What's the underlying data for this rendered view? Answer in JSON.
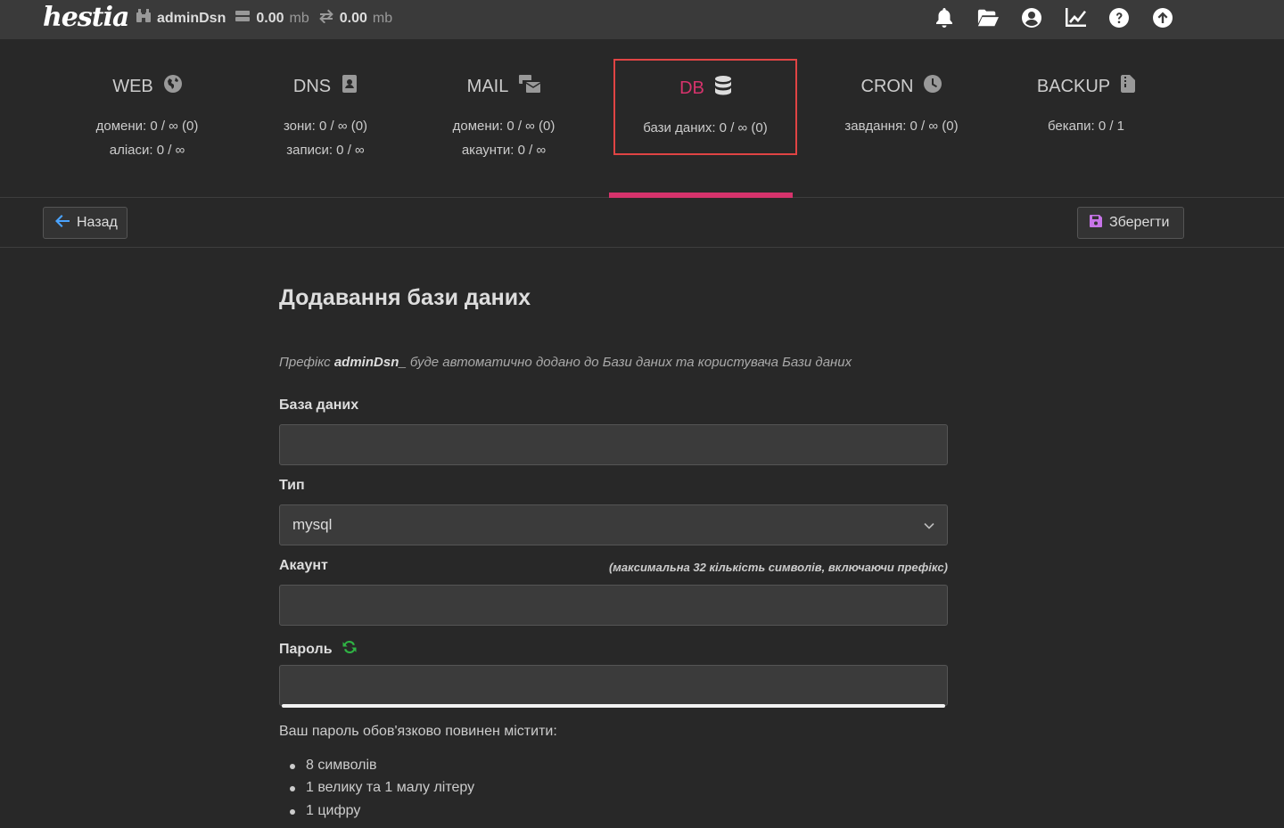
{
  "topbar": {
    "logo": "hestia",
    "user": "adminDsn",
    "disk_value": "0.00",
    "disk_unit": "mb",
    "bandwidth_value": "0.00",
    "bandwidth_unit": "mb",
    "icons": [
      "bell-icon",
      "folder-open-icon",
      "user-circle-icon",
      "chart-line-icon",
      "question-circle-icon",
      "arrow-up-circle-icon"
    ]
  },
  "panels": [
    {
      "title": "WEB",
      "icon": "globe-icon",
      "line1": "домени: 0 / ∞ (0)",
      "line2": "аліаси: 0 / ∞"
    },
    {
      "title": "DNS",
      "icon": "address-book-icon",
      "line1": "зони: 0 / ∞ (0)",
      "line2": "записи: 0 / ∞"
    },
    {
      "title": "MAIL",
      "icon": "mail-bulk-icon",
      "line1": "домени: 0 / ∞ (0)",
      "line2": "акаунти: 0 / ∞"
    },
    {
      "title": "DB",
      "icon": "database-icon",
      "line1": "бази даних: 0 / ∞ (0)",
      "line2": ""
    },
    {
      "title": "CRON",
      "icon": "clock-icon",
      "line1": "завдання: 0 / ∞ (0)",
      "line2": ""
    },
    {
      "title": "BACKUP",
      "icon": "file-archive-icon",
      "line1": "бекапи: 0 / 1",
      "line2": ""
    }
  ],
  "active_panel": "DB",
  "toolbar": {
    "back_label": "Назад",
    "save_label": "Зберегти"
  },
  "form": {
    "title": "Додавання бази даних",
    "hint_prefix": "Префікс",
    "hint_user": "adminDsn_",
    "hint_suffix": "буде автоматично додано до Бази даних та користувача Бази даних",
    "database_label": "База даних",
    "database_value": "",
    "type_label": "Тип",
    "type_value": "mysql",
    "account_label": "Акаунт",
    "account_note": "(максимальна 32 кількість символів, включаючи префікс)",
    "account_value": "",
    "password_label": "Пароль",
    "password_value": "",
    "password_info": "Ваш пароль обов'язково повинен містити:",
    "password_requirements": [
      "8 символів",
      "1 велику та 1 малу літеру",
      "1 цифру"
    ]
  },
  "colors": {
    "accent": "#d6336c",
    "highlight_border": "#e04444",
    "save_icon": "#c774e8",
    "refresh_icon": "#2fb344",
    "back_arrow": "#4aa3ff"
  }
}
